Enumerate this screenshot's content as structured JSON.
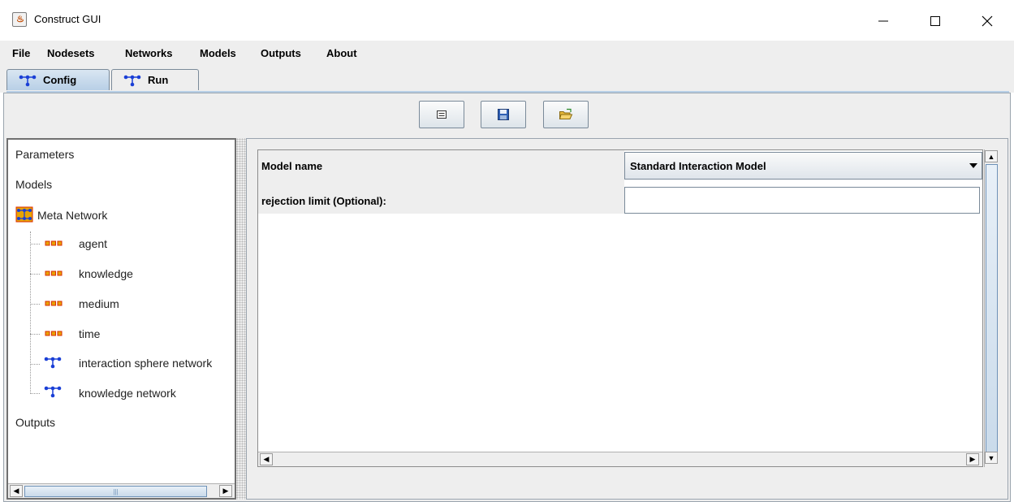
{
  "window": {
    "title": "Construct GUI",
    "minimize_glyph": "—",
    "maximize_glyph": "☐",
    "close_glyph": "✕"
  },
  "menu": [
    "File",
    "Nodesets",
    "Networks",
    "Models",
    "Outputs",
    "About"
  ],
  "tabs": [
    {
      "label": "Config",
      "icon": "network-icon",
      "selected": true
    },
    {
      "label": "Run",
      "icon": "network-icon",
      "selected": false
    }
  ],
  "toolbar": [
    {
      "name": "new-document-button",
      "icon": "document-icon"
    },
    {
      "name": "save-button",
      "icon": "floppy-disk-icon"
    },
    {
      "name": "open-folder-button",
      "icon": "open-folder-icon"
    }
  ],
  "tree": {
    "parameters": "Parameters",
    "models": "Models",
    "meta_network": "Meta Network",
    "nodesets": [
      "agent",
      "knowledge",
      "medium",
      "time"
    ],
    "networks": [
      "interaction sphere network",
      "knowledge network"
    ],
    "outputs": "Outputs"
  },
  "model_form": {
    "model_name_label": "Model name",
    "model_name_value": "Standard Interaction Model",
    "rejection_label": "rejection limit (Optional):",
    "rejection_value": ""
  },
  "colors": {
    "network_icon": "#1a3fd6",
    "nodeset_icon": "#e8a300",
    "nodeset_icon_border": "#d92b00",
    "tab_selected": "#b8cfe6"
  }
}
